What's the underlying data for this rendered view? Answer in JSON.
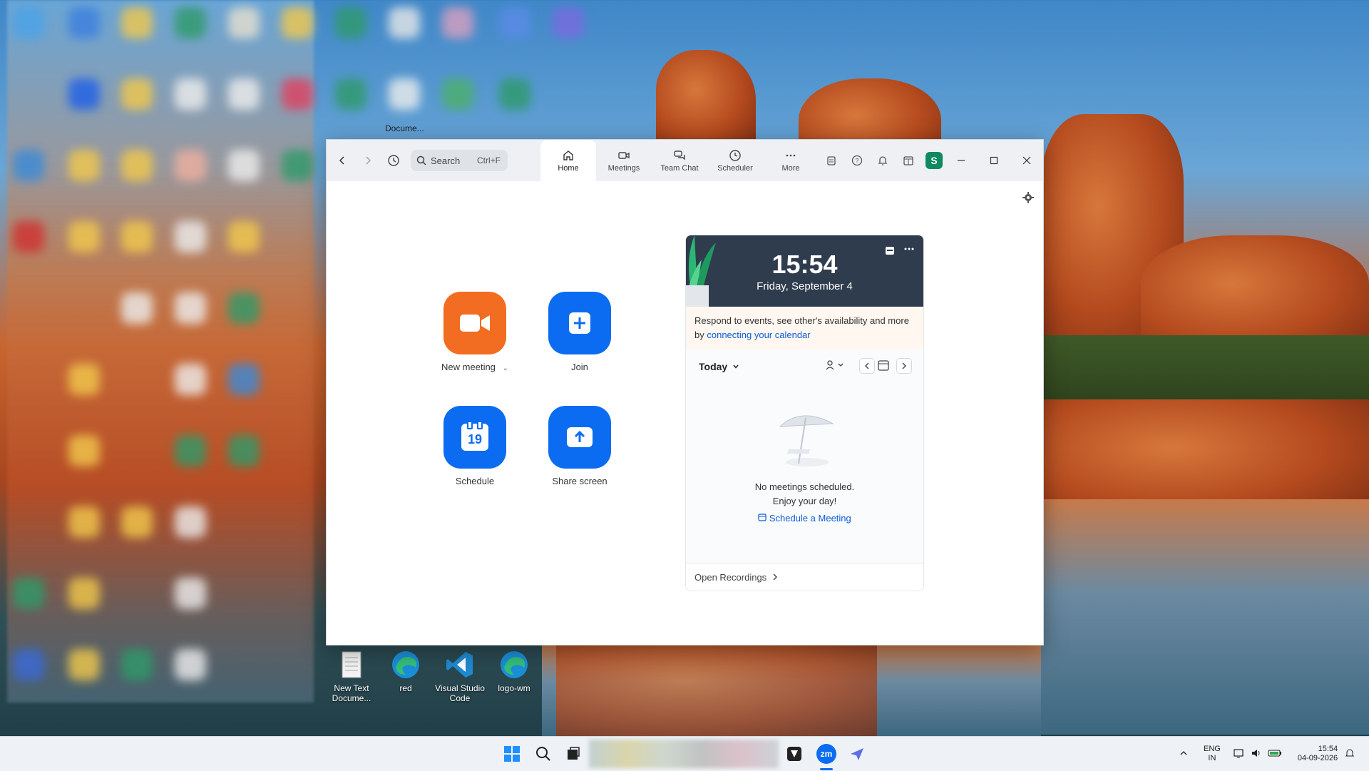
{
  "desktop": {
    "top_label": "Docume...",
    "icons": [
      {
        "label": "New Text Docume...",
        "icon": "text-file-icon"
      },
      {
        "label": "red",
        "icon": "edge-icon"
      },
      {
        "label": "Visual Studio Code",
        "icon": "vscode-icon"
      },
      {
        "label": "logo-wm",
        "icon": "edge-icon"
      }
    ]
  },
  "window": {
    "search": {
      "label": "Search",
      "shortcut": "Ctrl+F"
    },
    "tabs": [
      {
        "label": "Home",
        "icon": "home-icon",
        "active": true
      },
      {
        "label": "Meetings",
        "icon": "video-camera-icon"
      },
      {
        "label": "Team Chat",
        "icon": "chat-icon"
      },
      {
        "label": "Scheduler",
        "icon": "clock-icon"
      },
      {
        "label": "More",
        "icon": "more-dots-icon"
      }
    ],
    "avatar_initial": "S",
    "actions": {
      "new_meeting": "New meeting",
      "join": "Join",
      "schedule": "Schedule",
      "schedule_day": "19",
      "share_screen": "Share screen"
    },
    "calendar": {
      "time": "15:54",
      "date": "Friday, September 4",
      "notice_text": "Respond to events, see other's availability and more by",
      "notice_link": "connecting your calendar",
      "today_label": "Today",
      "empty_line1": "No meetings scheduled.",
      "empty_line2": "Enjoy your day!",
      "schedule_link": "Schedule a Meeting",
      "open_recordings": "Open Recordings"
    }
  },
  "taskbar": {
    "language_line1": "ENG",
    "language_line2": "IN",
    "time": "15:54",
    "date": "04-09-2026",
    "zoom_icon_text": "zm"
  },
  "colors": {
    "zoom_orange": "#f26d21",
    "zoom_blue": "#0b6cf2",
    "calendar_header": "#2f3c4d",
    "link": "#0b5cd7"
  }
}
